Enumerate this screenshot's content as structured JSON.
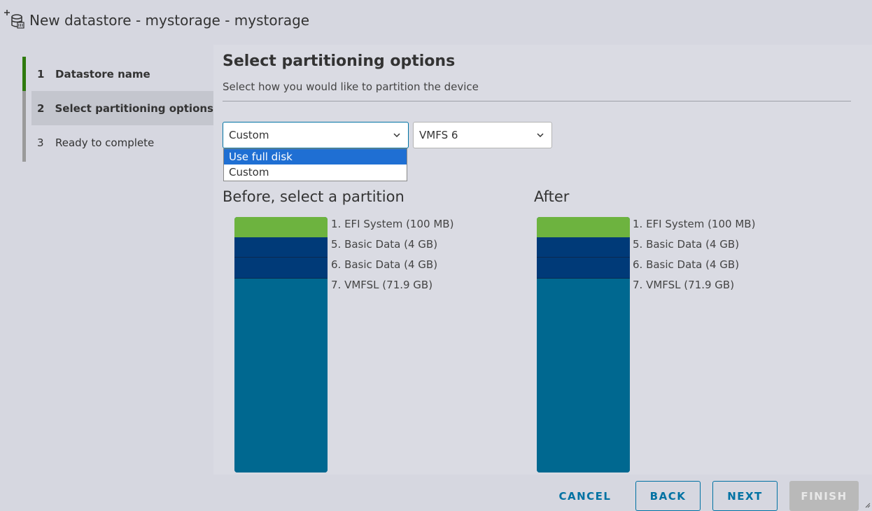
{
  "window": {
    "title": "New datastore - mystorage - mystorage"
  },
  "wizard": {
    "steps": [
      {
        "number": "1",
        "label": "Datastore name",
        "state": "done"
      },
      {
        "number": "2",
        "label": "Select partitioning options",
        "state": "active"
      },
      {
        "number": "3",
        "label": "Ready to complete",
        "state": "pending"
      }
    ]
  },
  "page": {
    "heading": "Select partitioning options",
    "subtitle": "Select how you would like to partition the device"
  },
  "partition_select": {
    "value": "Custom",
    "options": [
      "Use full disk",
      "Custom"
    ],
    "highlighted": "Use full disk"
  },
  "vmfs_select": {
    "value": "VMFS 6"
  },
  "before": {
    "heading": "Before, select a partition",
    "partitions": [
      {
        "label": "1. EFI System  (100 MB)",
        "color": "#6db33f"
      },
      {
        "label": "5. Basic Data  (4 GB)",
        "color": "#003a78"
      },
      {
        "label": "6. Basic Data  (4 GB)",
        "color": "#003a78"
      },
      {
        "label": "7. VMFSL  (71.9 GB)",
        "color": "#006890"
      }
    ]
  },
  "after": {
    "heading": "After",
    "partitions": [
      {
        "label": "1. EFI System  (100 MB)",
        "color": "#6db33f"
      },
      {
        "label": "5. Basic Data  (4 GB)",
        "color": "#003a78"
      },
      {
        "label": "6. Basic Data  (4 GB)",
        "color": "#003a78"
      },
      {
        "label": "7. VMFSL  (71.9 GB)",
        "color": "#006890"
      }
    ]
  },
  "footer": {
    "cancel": "CANCEL",
    "back": "BACK",
    "next": "NEXT",
    "finish": "FINISH"
  },
  "colors": {
    "accent": "#0072a3",
    "step_done": "#2f7a0e",
    "dropdown_highlight": "#1f6fd3"
  }
}
